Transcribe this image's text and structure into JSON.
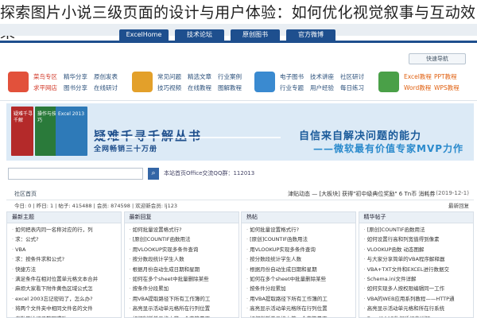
{
  "article": {
    "title": "探索图片小说三级页面的设计与用户体验：如何优化视觉叙事与互动效果"
  },
  "nav": {
    "tabs": [
      "ExcelHome",
      "技术论坛",
      "原创图书",
      "官方微博"
    ],
    "login": "快速导航"
  },
  "menu": [
    {
      "icon": "hot-icon",
      "color": "#e2513b",
      "items": [
        [
          "菜鸟专区",
          "精华分享",
          "原创发表"
        ],
        [
          "求平网店",
          "图书分享",
          "在线研讨"
        ]
      ]
    },
    {
      "icon": "film-icon",
      "color": "#e3a02a",
      "items": [
        [
          "常见问题",
          "精选文章",
          "行业案例"
        ],
        [
          "技巧视频",
          "在线教程",
          "图解教程"
        ]
      ]
    },
    {
      "icon": "mail-icon",
      "color": "#3a8ad0",
      "items": [
        [
          "电子图书",
          "技术讲座",
          "社区研讨"
        ],
        [
          "行业专题",
          "用户经验",
          "每日练习"
        ]
      ]
    },
    {
      "icon": "book-icon",
      "color": "#4aa048",
      "items": [
        [
          "Excel教程",
          "PPT教程"
        ],
        [
          "Word教程",
          "WPS教程"
        ]
      ]
    }
  ],
  "banner": {
    "books": [
      "疑难千寻千解",
      "Excel 2013",
      "操作与技巧"
    ],
    "slogan_main": "疑难千寻千解丛书",
    "slogan_sub": "全网畅销三十万册",
    "right_main": "自信来自解决问题的能力",
    "right_sub": "——微软最有价值专家MVP力作"
  },
  "search": {
    "placeholder": "",
    "button_icon": "search-icon",
    "note": "本站首页Office交流QQ群：112013"
  },
  "breadcrumb": {
    "home": "社区首页",
    "moderator": "津贴动态 — [大板块] 获得\"初中级典位奖励\" 6 Tn币 消耗券",
    "date": "(2019-12-1)"
  },
  "stats": {
    "left": "今日: 0 | 昨日: 1 | 帖子: 415488 | 会员: 874598 | 欢迎新会员: lj123",
    "right": "最新回复"
  },
  "columns": [
    {
      "title": "最新主题",
      "items": [
        "如何把表内同一名称对应的行，列",
        "求：公式?",
        "VBA",
        "求：按条件求和公式?",
        "快捷方法",
        "满足条件在相对位置单元格文本合并",
        "麻烦大家看下附件黄色区域公式怎",
        "excel 2003忘记密码了，怎么办?",
        "将两个文件夹中相同文件名的文件",
        "考勤原始记录整理求助"
      ]
    },
    {
      "title": "最新回复",
      "items": [
        "如何批量设置格式行?",
        "[原创]COUNTIF函数用法",
        "用VLOOKUP实现多条件查询",
        "按分数段统计学生人数",
        "根据月份自动生成日期和星期",
        "如何在多个sheet中批量删除某些",
        "按条件分段累加",
        "用VBA提取路径下所有工作簿的工",
        "高亮显示活动单元格所在行列位置",
        "如何判断单元格中第一个字符是否"
      ]
    },
    {
      "title": "热帖",
      "items": [
        "如何批量设置格式行?",
        "[原创]COUNTIF函数用法",
        "用VLOOKUP实现多条件查询",
        "按分数段统计学生人数",
        "根据月份自动生成日期和星期",
        "如何在多个sheet中批量删除某些",
        "按条件分段累加",
        "用VBA提取路径下所有工作簿的工",
        "高亮显示活动单元格所在行列位置",
        "如何判断单元格中第一个字符是否"
      ]
    },
    {
      "title": "精华帖子",
      "items": [
        "[原创]COUNTIF函数用法",
        "如何设置行高和列宽值得到像素",
        "VLOOKUP函数 动态图解",
        "与大家分享简单的VBA程序解释器",
        "VBA+TXT文件和EXCEL进行数据交",
        "Schema.ini文件详解",
        "如何实现多人按权限编辑同一工作",
        "VBA的WEB应用系列教程——HTTP通",
        "高亮显示活动单元格和所在行系统",
        "Excel2007数据透视表详解"
      ]
    }
  ],
  "colors": {
    "nav": "#1e4f8e",
    "banner": "#dceaf6",
    "accent_red": "#d23a2a"
  }
}
